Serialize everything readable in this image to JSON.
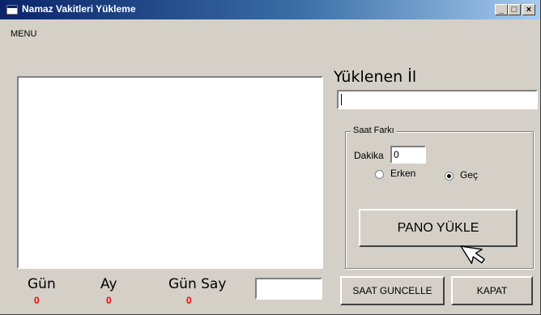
{
  "window": {
    "title": "Namaz Vakitleri Yükleme",
    "minimize_glyph": "_",
    "maximize_glyph": "□",
    "close_glyph": "×"
  },
  "menu": {
    "label": "MENU"
  },
  "yuklenen_il": {
    "label": "Yüklenen İl",
    "value": ""
  },
  "saat_farki": {
    "legend": "Saat Farkı",
    "dakika_label": "Dakika",
    "dakika_value": "0",
    "options": [
      {
        "label": "Erken",
        "selected": false
      },
      {
        "label": "Geç",
        "selected": true
      }
    ]
  },
  "buttons": {
    "pano_yukle": "PANO YÜKLE",
    "saat_guncelle": "SAAT GUNCELLE",
    "kapat": "KAPAT"
  },
  "counters": {
    "gun_label": "Gün",
    "gun_value": "0",
    "ay_label": "Ay",
    "ay_value": "0",
    "gunsay_label": "Gün Say",
    "gunsay_value": "0",
    "gunsay_input": ""
  },
  "icons": [
    "app-icon",
    "minimize-icon",
    "maximize-icon",
    "close-icon",
    "hand-cursor-icon"
  ],
  "colors": {
    "title_start": "#0a246a",
    "title_end": "#a6caf0",
    "value_red": "#ff0000",
    "face": "#d4d0c8"
  }
}
